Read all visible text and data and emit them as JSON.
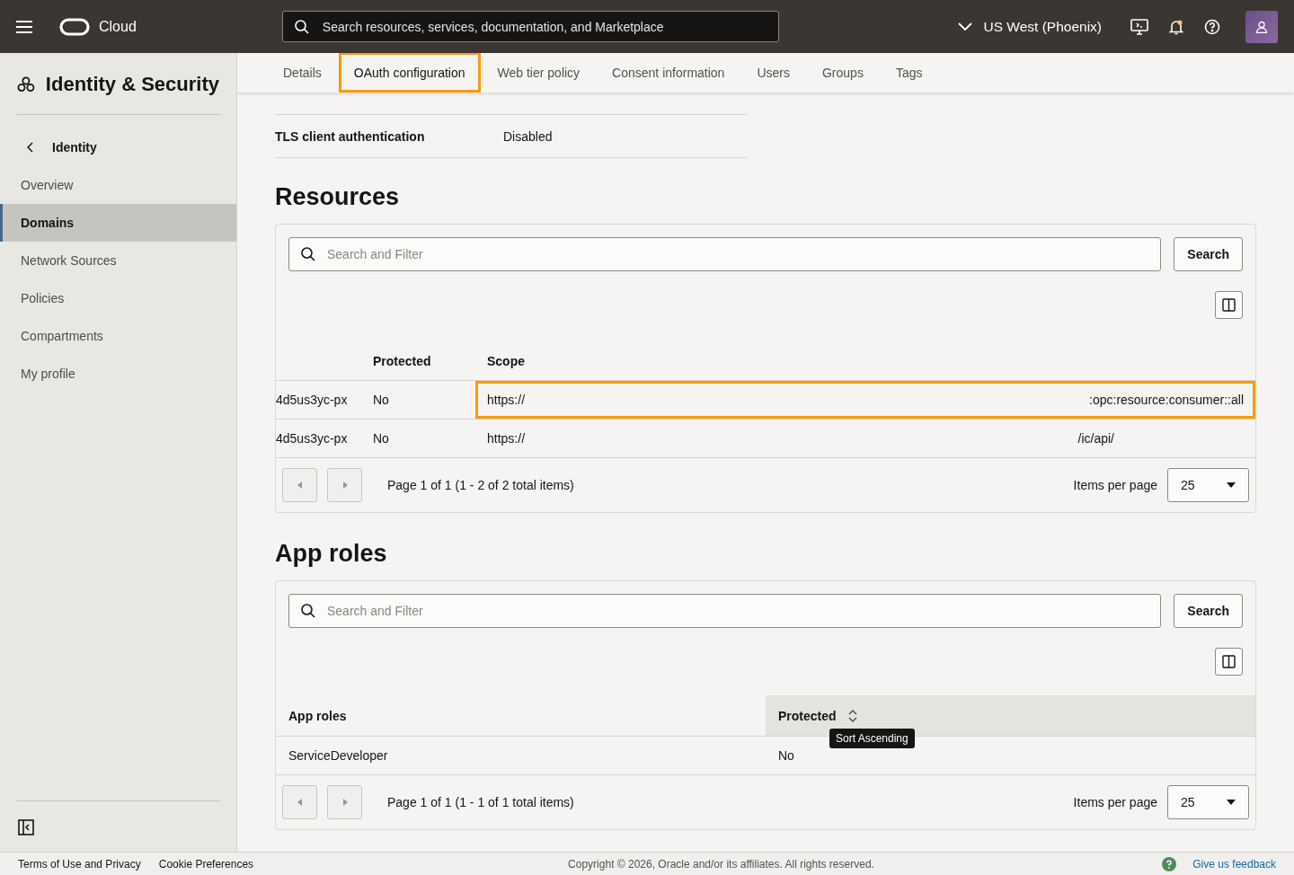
{
  "topbar": {
    "brand": "Cloud",
    "search_placeholder": "Search resources, services, documentation, and Marketplace",
    "region": "US West (Phoenix)"
  },
  "sidebar": {
    "title": "Identity & Security",
    "back_label": "Identity",
    "items": [
      {
        "label": "Overview",
        "selected": false
      },
      {
        "label": "Domains",
        "selected": true
      },
      {
        "label": "Network Sources",
        "selected": false
      },
      {
        "label": "Policies",
        "selected": false
      },
      {
        "label": "Compartments",
        "selected": false
      },
      {
        "label": "My profile",
        "selected": false
      }
    ]
  },
  "tabs": [
    {
      "label": "Details",
      "selected": false
    },
    {
      "label": "OAuth configuration",
      "selected": true
    },
    {
      "label": "Web tier policy",
      "selected": false
    },
    {
      "label": "Consent information",
      "selected": false
    },
    {
      "label": "Users",
      "selected": false
    },
    {
      "label": "Groups",
      "selected": false
    },
    {
      "label": "Tags",
      "selected": false
    }
  ],
  "properties": [
    {
      "label": "TLS client authentication",
      "value": "Disabled"
    }
  ],
  "resources": {
    "title": "Resources",
    "search_placeholder": "Search and Filter",
    "search_button": "Search",
    "columns": [
      "Protected",
      "Scope"
    ],
    "rows": [
      {
        "name": "4d5us3yc-px",
        "protected": "No",
        "scope_start": "https://",
        "scope_end": ":opc:resource:consumer::all",
        "highlighted": true
      },
      {
        "name": "4d5us3yc-px",
        "protected": "No",
        "scope_start": "https://",
        "scope_end": "/ic/api/",
        "highlighted": false
      }
    ],
    "page_info": "Page 1 of 1 (1 - 2 of 2 total items)",
    "per_page_label": "Items per page",
    "per_page": "25"
  },
  "app_roles": {
    "title": "App roles",
    "search_placeholder": "Search and Filter",
    "search_button": "Search",
    "columns": [
      {
        "label": "App roles",
        "sortable": false
      },
      {
        "label": "Protected",
        "sortable": true
      }
    ],
    "rows": [
      {
        "name": "ServiceDeveloper",
        "protected": "No"
      }
    ],
    "tooltip": "Sort Ascending",
    "page_info": "Page 1 of 1 (1 - 1 of 1 total items)",
    "per_page_label": "Items per page",
    "per_page": "25"
  },
  "footer": {
    "links": [
      "Terms of Use and Privacy",
      "Cookie Preferences"
    ],
    "copyright": "Copyright © 2026, Oracle and/or its affiliates. All rights reserved.",
    "feedback": "Give us feedback"
  }
}
